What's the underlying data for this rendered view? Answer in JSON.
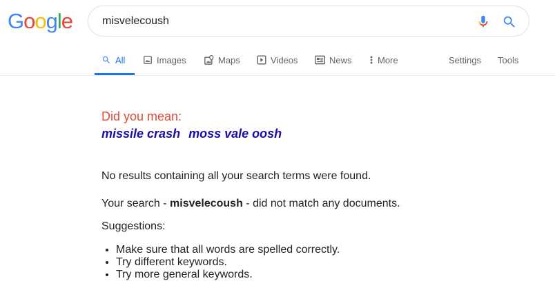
{
  "logo": {
    "letters": [
      "G",
      "o",
      "o",
      "g",
      "l",
      "e"
    ],
    "colors": [
      "#4285f4",
      "#ea4335",
      "#fbbc05",
      "#4285f4",
      "#34a853",
      "#ea4335"
    ]
  },
  "search": {
    "query": "misvelecoush",
    "icons": [
      "mic-icon",
      "search-icon"
    ]
  },
  "tabs": [
    {
      "label": "All",
      "icon": "search-icon",
      "active": true
    },
    {
      "label": "Images",
      "icon": "image-icon"
    },
    {
      "label": "Maps",
      "icon": "map-icon"
    },
    {
      "label": "Videos",
      "icon": "play-icon"
    },
    {
      "label": "News",
      "icon": "news-icon"
    },
    {
      "label": "More",
      "icon": "more-vertical-icon"
    }
  ],
  "tools": {
    "settings": "Settings",
    "tools": "Tools"
  },
  "did_you_mean": {
    "label": "Did you mean:",
    "suggestions": [
      "missile crash",
      "moss vale oosh"
    ]
  },
  "results": {
    "no_results": "No results containing all your search terms were found.",
    "your_search_prefix": "Your search - ",
    "your_search_term": "misvelecoush",
    "your_search_suffix": " - did not match any documents.",
    "suggestions_title": "Suggestions:",
    "suggestions": [
      "Make sure that all words are spelled correctly.",
      "Try different keywords.",
      "Try more general keywords."
    ]
  },
  "colors": {
    "accent": "#1a73e8",
    "link": "#1a0dab",
    "did_you_mean": "#dd4b39"
  }
}
